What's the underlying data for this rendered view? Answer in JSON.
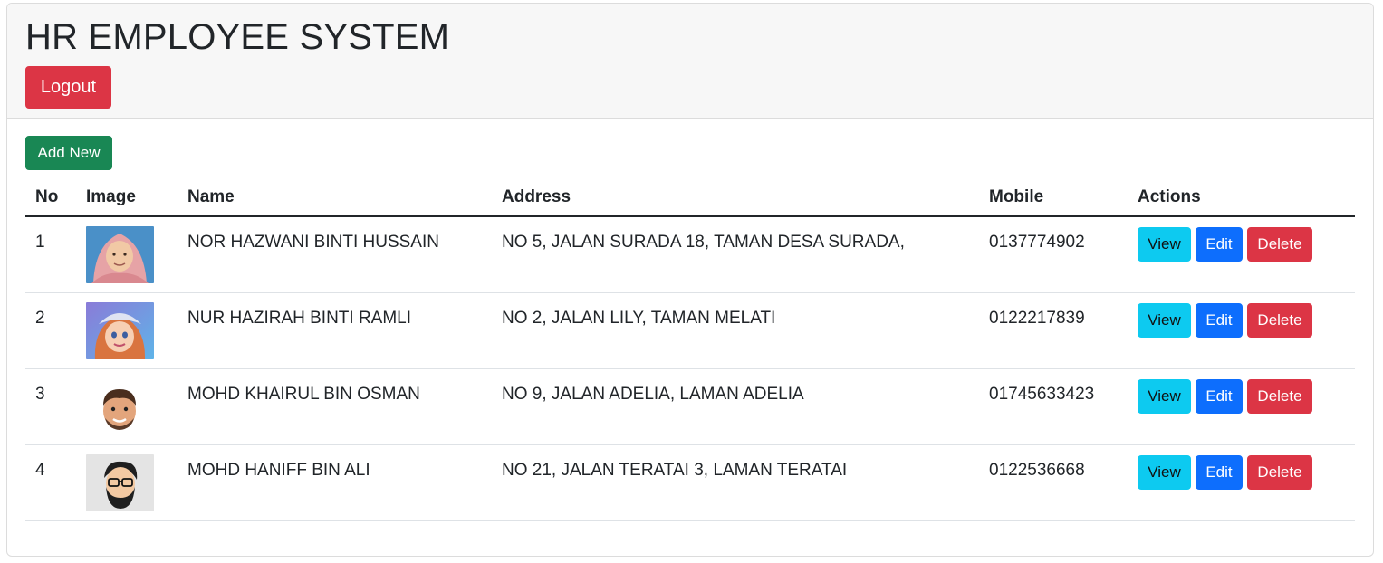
{
  "header": {
    "title": "HR EMPLOYEE SYSTEM",
    "logout_label": "Logout"
  },
  "toolbar": {
    "add_label": "Add New"
  },
  "table": {
    "columns": [
      "No",
      "Image",
      "Name",
      "Address",
      "Mobile",
      "Actions"
    ],
    "rows": [
      {
        "no": "1",
        "avatar": "woman-hijab-photo",
        "name": "NOR HAZWANI BINTI HUSSAIN",
        "address": "NO 5, JALAN SURADA 18, TAMAN DESA SURADA,",
        "mobile": "0137774902"
      },
      {
        "no": "2",
        "avatar": "cartoon-girl-avatar",
        "name": "NUR HAZIRAH BINTI RAMLI",
        "address": "NO 2, JALAN LILY, TAMAN MELATI",
        "mobile": "0122217839"
      },
      {
        "no": "3",
        "avatar": "cartoon-man-avatar",
        "name": "MOHD KHAIRUL BIN OSMAN",
        "address": "NO 9, JALAN ADELIA, LAMAN ADELIA",
        "mobile": "01745633423"
      },
      {
        "no": "4",
        "avatar": "bearded-man-glasses-avatar",
        "name": "MOHD HANIFF BIN ALI",
        "address": "NO 21, JALAN TERATAI 3, LAMAN TERATAI",
        "mobile": "0122536668"
      }
    ],
    "actions": {
      "view": "View",
      "edit": "Edit",
      "delete": "Delete"
    }
  },
  "colors": {
    "danger": "#dc3545",
    "success": "#198754",
    "info": "#0dcaf0",
    "primary": "#0d6efd"
  }
}
